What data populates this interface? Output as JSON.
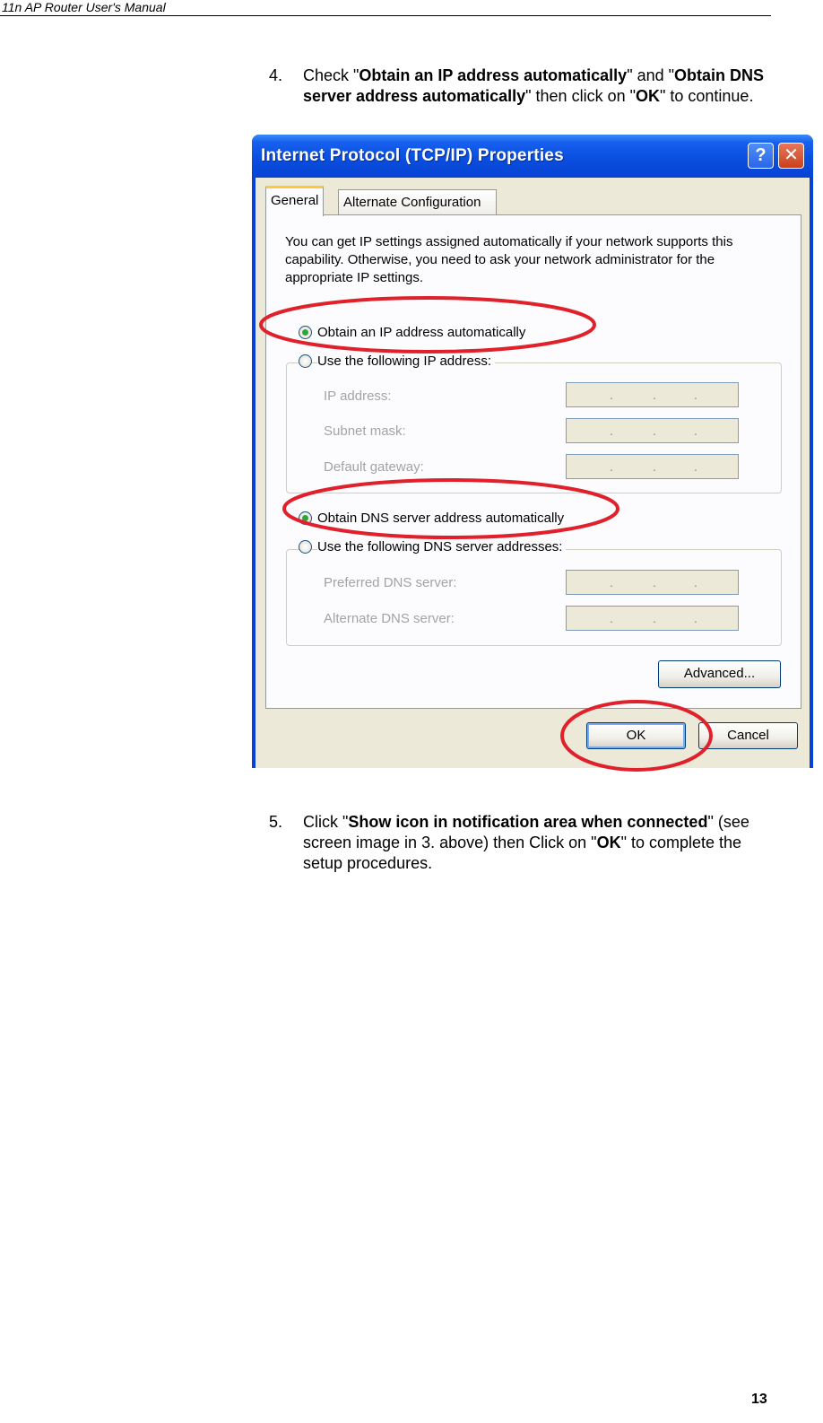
{
  "header": {
    "title": "11n AP Router User's Manual"
  },
  "step4": {
    "number": "4.",
    "t1": "Check \"",
    "b1": "Obtain an IP address automatically",
    "t2": "\" and \"",
    "b2": "Obtain DNS server address automatically",
    "t3": "\" then click on \"",
    "b3": "OK",
    "t4": "\" to continue."
  },
  "dialog": {
    "title": "Internet Protocol (TCP/IP) Properties",
    "help_glyph": "?",
    "close_glyph": "✕",
    "tabs": {
      "general": "General",
      "alternate": "Alternate Configuration"
    },
    "info": "You can get IP settings assigned automatically if your network supports this capability. Otherwise, you need to ask your network administrator for the appropriate IP settings.",
    "ip_auto": "Obtain an IP address automatically",
    "ip_manual": "Use the following IP address:",
    "ip_address_label": "IP address:",
    "subnet_mask_label": "Subnet mask:",
    "gateway_label": "Default gateway:",
    "dns_auto": "Obtain DNS server address automatically",
    "dns_manual": "Use the following DNS server addresses:",
    "preferred_dns_label": "Preferred DNS server:",
    "alternate_dns_label": "Alternate DNS server:",
    "ip_dot": ".",
    "advanced_button": "Advanced...",
    "ok_button": "OK",
    "cancel_button": "Cancel",
    "highlight_color": "#e0202a"
  },
  "step5": {
    "number": "5.",
    "t1": "Click \"",
    "b1": "Show icon in notification area when connected",
    "t2": "\" (see screen image in 3. above) then Click on \"",
    "b2": "OK",
    "t3": "\" to complete the setup procedures."
  },
  "footer": {
    "page_number": "13"
  }
}
